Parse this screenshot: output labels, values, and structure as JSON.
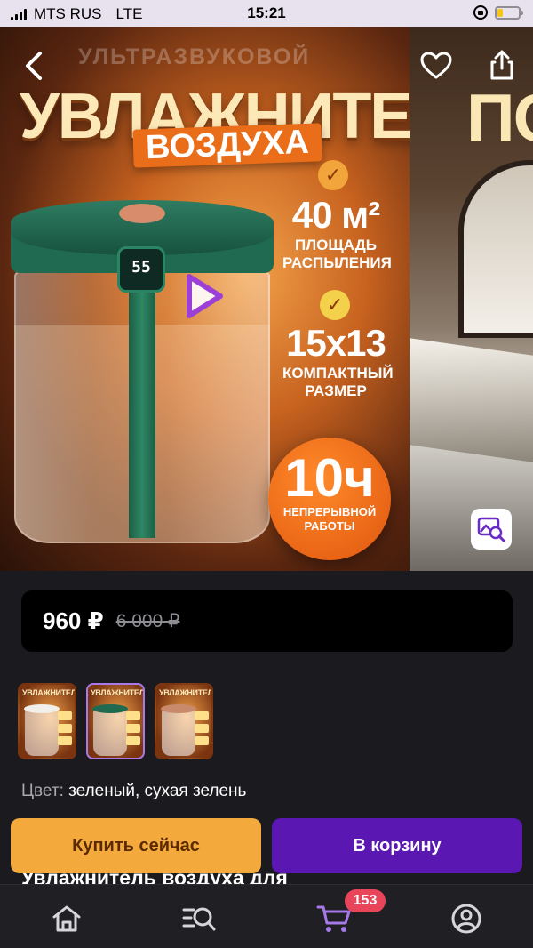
{
  "status_bar": {
    "carrier": "MTS RUS",
    "network": "LTE",
    "time": "15:21",
    "battery_level": 0.25
  },
  "gallery": {
    "back_icon": "chevron-left-icon",
    "favorite_icon": "heart-icon",
    "share_icon": "share-icon",
    "play_icon": "play-icon",
    "image_search_icon": "image-search-icon",
    "slide1": {
      "small_title": "УЛЬТРАЗВУКОВОЙ",
      "big_title": "УВЛАЖНИТЕЛЬ",
      "badge": "ВОЗДУХА",
      "display": "55",
      "feature1_big": "40 м²",
      "feature1_sub1": "ПЛОЩАДЬ",
      "feature1_sub2": "РАСПЫЛЕНИЯ",
      "feature2_big": "15х13",
      "feature2_sub1": "КОМПАКТНЫЙ",
      "feature2_sub2": "РАЗМЕР",
      "hours_big": "10ч",
      "hours_sub1": "НЕПРЕРЫВНОЙ",
      "hours_sub2": "РАБОТЫ"
    },
    "slide2": {
      "title": "ПО"
    }
  },
  "price": {
    "current": "960 ₽",
    "old": "6 000 ₽"
  },
  "thumbnails": [
    {
      "label": "УВЛАЖНИТЕЛЬ",
      "lid_color": "#f1efe9",
      "selected": false
    },
    {
      "label": "УВЛАЖНИТЕЛЬ",
      "lid_color": "#1f6a50",
      "selected": true
    },
    {
      "label": "УВЛАЖНИТЕЛЬ",
      "lid_color": "#c98a6c",
      "selected": false
    }
  ],
  "color": {
    "label": "Цвет:",
    "value": "зеленый, сухая зелень"
  },
  "actions": {
    "buy_now": "Купить сейчас",
    "add_to_cart": "В корзину"
  },
  "product_title_peek": "Увлажнитель воздуха для",
  "tabbar": {
    "home_icon": "home-icon",
    "search_icon": "catalog-search-icon",
    "cart_icon": "cart-icon",
    "profile_icon": "profile-icon",
    "cart_count": "153"
  },
  "colors": {
    "accent_purple": "#5b17b2",
    "accent_orange": "#f4a93c",
    "badge_red": "#e8455a",
    "background": "#1b1b1f"
  }
}
